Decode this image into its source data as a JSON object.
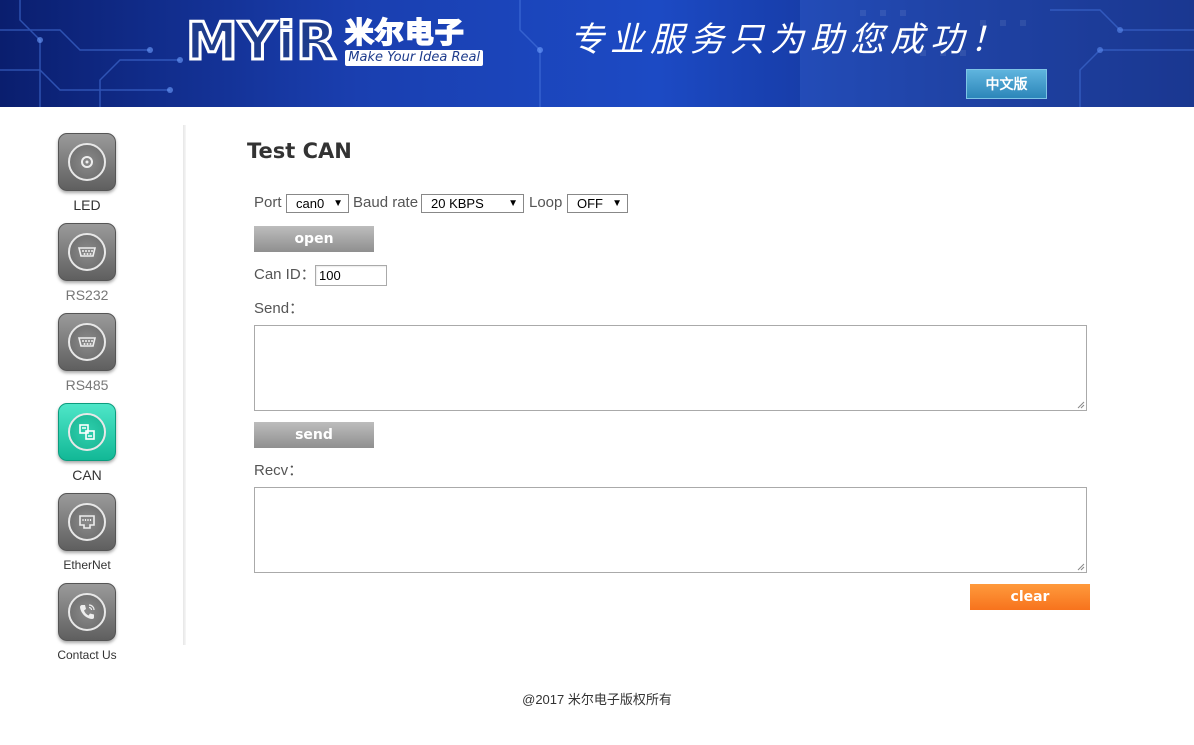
{
  "header": {
    "logo_text": "MYiR",
    "logo_cn": "米尔电子",
    "logo_tagline": "Make Your Idea Real",
    "slogan": "专业服务只为助您成功！",
    "lang_button": "中文版",
    "colors": {
      "banner": "#1a3fb0",
      "lang_button": "#3a98c9"
    }
  },
  "sidebar": {
    "items": [
      {
        "label": "LED",
        "icon": "led-icon",
        "active": false
      },
      {
        "label": "RS232",
        "icon": "serial-port-icon",
        "active": false
      },
      {
        "label": "RS485",
        "icon": "serial-port-icon",
        "active": false
      },
      {
        "label": "CAN",
        "icon": "can-bus-icon",
        "active": true
      },
      {
        "label": "EtherNet",
        "icon": "ethernet-port-icon",
        "active": false
      },
      {
        "label": "Contact Us",
        "icon": "phone-icon",
        "active": false
      }
    ],
    "active_color": "#1fc8a4"
  },
  "main": {
    "title": "Test CAN",
    "port": {
      "label": "Port",
      "value": "can0"
    },
    "baud_rate": {
      "label": "Baud rate",
      "value": "20 KBPS"
    },
    "loop": {
      "label": "Loop",
      "value": "OFF"
    },
    "open_button": "open",
    "can_id": {
      "label": "Can ID：",
      "value": "100"
    },
    "send": {
      "label": "Send：",
      "value": ""
    },
    "send_button": "send",
    "recv": {
      "label": "Recv：",
      "value": ""
    },
    "clear_button": "clear",
    "colors": {
      "clear_button": "#f7731d",
      "gray_button": "#a6a6a6"
    }
  },
  "footer": {
    "text": "@2017 米尔电子版权所有"
  }
}
